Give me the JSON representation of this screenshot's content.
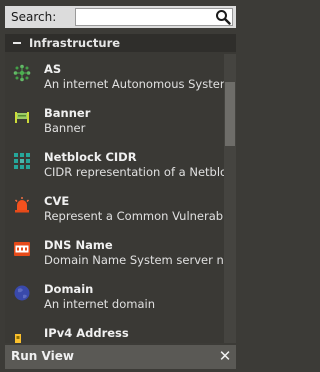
{
  "search": {
    "label": "Search:",
    "value": "",
    "placeholder": ""
  },
  "category": {
    "label": "Infrastructure",
    "expanded": true
  },
  "entities": [
    {
      "name": "AS",
      "description": "An internet Autonomous System",
      "icon": "as-icon",
      "color": "#4caf50"
    },
    {
      "name": "Banner",
      "description": "Banner",
      "icon": "banner-icon",
      "color": "#8bc34a"
    },
    {
      "name": "Netblock CIDR",
      "description": "CIDR representation of a Netbloc",
      "icon": "netblock-icon",
      "color": "#26a69a"
    },
    {
      "name": "CVE",
      "description": "Represent a Common Vulnerabili",
      "icon": "cve-icon",
      "color": "#f4511e"
    },
    {
      "name": "DNS Name",
      "description": "Domain Name System server na",
      "icon": "dns-icon",
      "color": "#e64a19"
    },
    {
      "name": "Domain",
      "description": "An internet domain",
      "icon": "domain-icon",
      "color": "#3f51b5"
    },
    {
      "name": "IPv4 Address",
      "description": "",
      "icon": "ipv4-icon",
      "color": "#fbc02d"
    }
  ],
  "runview": {
    "title": "Run View",
    "close_glyph": "✕"
  }
}
